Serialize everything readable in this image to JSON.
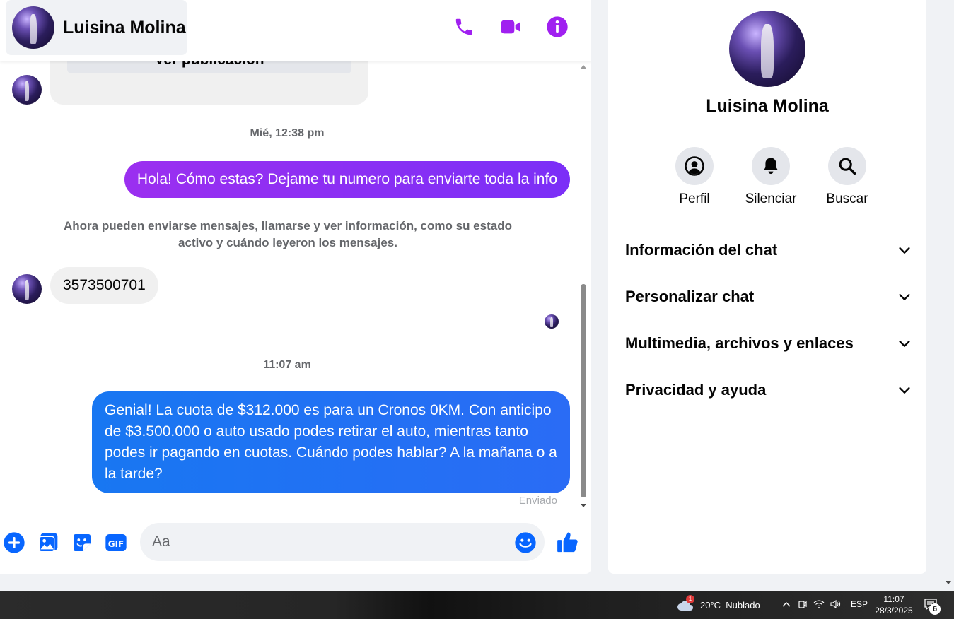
{
  "header": {
    "contact_name": "Luisina Molina",
    "actions": [
      "phone-icon",
      "video-camera-icon",
      "info-icon"
    ]
  },
  "messages": {
    "post_button_label": "Ver publicación",
    "timestamp_1": "Mié, 12:38 pm",
    "outgoing_1": "Hola! Cómo estas? Dejame tu numero para enviarte toda la info",
    "system_note": "Ahora pueden enviarse mensajes, llamarse y ver información, como su estado activo y cuándo leyeron los mensajes.",
    "incoming_1": "3573500701",
    "timestamp_2": "11:07 am",
    "outgoing_2": "Genial! La cuota de $312.000 es para un Cronos 0KM. Con anticipo de $3.500.000 o auto usado podes retirar el auto, mientras tanto podes ir pagando en cuotas. Cuándo podes hablar? A la mañana o a la tarde?",
    "sent_status": "Enviado"
  },
  "composer": {
    "placeholder": "Aa",
    "icons": [
      "plus-icon",
      "image-icon",
      "sticker-icon",
      "gif-icon",
      "emoji-icon",
      "thumbs-up-icon"
    ],
    "gif_label": "GIF"
  },
  "info_panel": {
    "name": "Luisina Molina",
    "quick_actions": [
      {
        "label": "Perfil",
        "icon": "profile-icon"
      },
      {
        "label": "Silenciar",
        "icon": "bell-icon"
      },
      {
        "label": "Buscar",
        "icon": "search-icon"
      }
    ],
    "sections": [
      {
        "label": "Información del chat"
      },
      {
        "label": "Personalizar chat"
      },
      {
        "label": "Multimedia, archivos y enlaces"
      },
      {
        "label": "Privacidad y ayuda"
      }
    ]
  },
  "taskbar": {
    "weather_badge": "1",
    "weather_text": "20°C  Nublado",
    "language": "ESP",
    "time": "11:07",
    "date": "28/3/2025",
    "notification_count": "6"
  },
  "colors": {
    "messenger_purple": "#a020f0",
    "outgoing_purple": "#8a2be2",
    "outgoing_blue": "#1877f2",
    "composer_blue": "#0866ff"
  }
}
